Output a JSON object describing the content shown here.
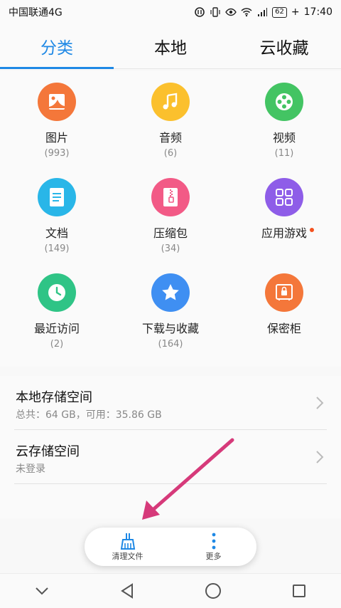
{
  "status": {
    "carrier": "中国联通4G",
    "battery": "62",
    "time": "17:40"
  },
  "tabs": [
    {
      "label": "分类",
      "active": true
    },
    {
      "label": "本地",
      "active": false
    },
    {
      "label": "云收藏",
      "active": false
    }
  ],
  "categories": [
    {
      "label": "图片",
      "count": "(993)",
      "color": "#f4773a",
      "icon": "image-icon"
    },
    {
      "label": "音频",
      "count": "(6)",
      "color": "#fbc02d",
      "icon": "music-icon"
    },
    {
      "label": "视频",
      "count": "(11)",
      "color": "#43c463",
      "icon": "video-icon"
    },
    {
      "label": "文档",
      "count": "(149)",
      "color": "#29b6e8",
      "icon": "document-icon"
    },
    {
      "label": "压缩包",
      "count": "(34)",
      "color": "#f25a86",
      "icon": "zip-icon"
    },
    {
      "label": "应用游戏",
      "count": "",
      "color": "#8e5de8",
      "icon": "apps-icon"
    },
    {
      "label": "最近访问",
      "count": "(2)",
      "color": "#2fc486",
      "icon": "clock-icon"
    },
    {
      "label": "下载与收藏",
      "count": "(164)",
      "color": "#3f8ff2",
      "icon": "star-icon"
    },
    {
      "label": "保密柜",
      "count": "",
      "color": "#f4773a",
      "icon": "safe-icon"
    }
  ],
  "storage": {
    "local_title": "本地存储空间",
    "local_sub": "总共：64 GB，可用：35.86 GB",
    "cloud_title": "云存储空间",
    "cloud_sub": "未登录"
  },
  "toolbar": {
    "clean_label": "清理文件",
    "more_label": "更多"
  },
  "colors": {
    "accent": "#1e88e5",
    "annotation_arrow": "#d63a7a"
  }
}
